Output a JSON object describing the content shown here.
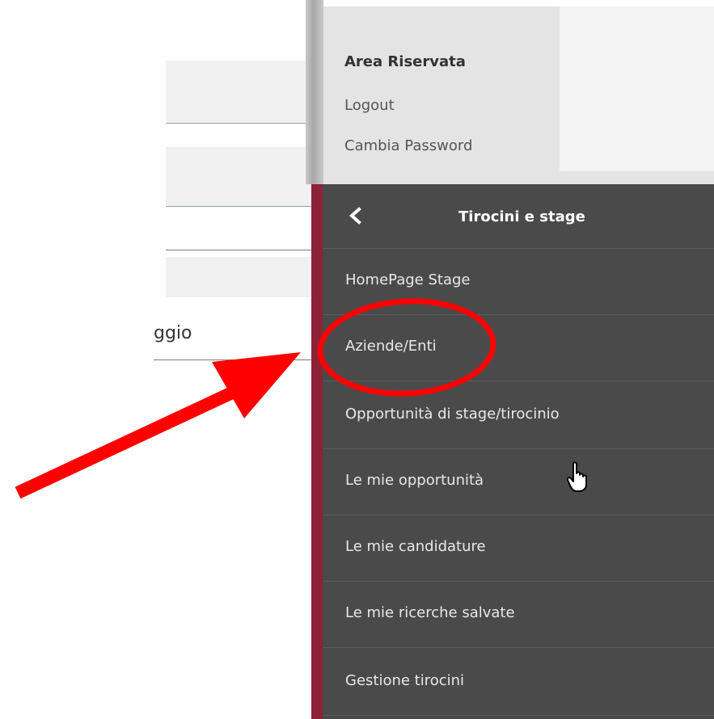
{
  "background_form": {
    "partial_field_text": "ggio"
  },
  "user_box": {
    "title": "Area Riservata",
    "logout_label": "Logout",
    "change_password_label": "Cambia Password"
  },
  "menu": {
    "title": "Tirocini e stage",
    "back_icon": "chevron-left-icon",
    "items": [
      {
        "label": "HomePage Stage"
      },
      {
        "label": "Aziende/Enti"
      },
      {
        "label": "Opportunità di stage/tirocinio"
      },
      {
        "label": "Le mie opportunità"
      },
      {
        "label": "Le mie candidature"
      },
      {
        "label": "Le mie ricerche salvate"
      },
      {
        "label": "Gestione tirocini"
      }
    ]
  },
  "colors": {
    "menu_background": "#4a4a4a",
    "menu_accent": "#8c2237",
    "annotation": "#ff0000"
  }
}
